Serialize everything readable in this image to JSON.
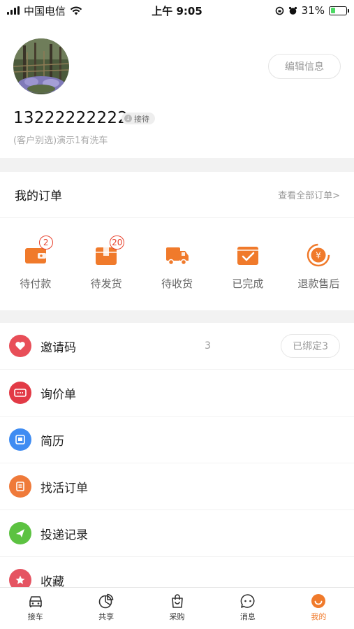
{
  "status_bar": {
    "carrier": "中国电信",
    "time": "上午 9:05",
    "battery": "31%"
  },
  "profile": {
    "phone": "13222222222",
    "role_badge": "接待",
    "subline": "(客户别选)演示1有洗车",
    "edit_label": "编辑信息"
  },
  "orders": {
    "title": "我的订单",
    "view_all": "查看全部订单>",
    "items": [
      {
        "label": "待付款",
        "badge": "2",
        "icon": "wallet-icon"
      },
      {
        "label": "待发货",
        "badge": "20",
        "icon": "package-icon"
      },
      {
        "label": "待收货",
        "badge": "",
        "icon": "truck-icon"
      },
      {
        "label": "已完成",
        "badge": "",
        "icon": "completed-box-icon"
      },
      {
        "label": "退款售后",
        "badge": "",
        "icon": "refund-icon"
      }
    ]
  },
  "menu": {
    "items": [
      {
        "label": "邀请码",
        "count": "3",
        "button": "已绑定3",
        "icon": "heart-icon",
        "color": "#e84e58"
      },
      {
        "label": "询价单",
        "icon": "quote-icon",
        "color": "#e23a46"
      },
      {
        "label": "简历",
        "icon": "resume-icon",
        "color": "#3f8cf2"
      },
      {
        "label": "找活订单",
        "icon": "job-order-icon",
        "color": "#ef7a3a"
      },
      {
        "label": "投递记录",
        "icon": "send-icon",
        "color": "#5cc241"
      },
      {
        "label": "收藏",
        "icon": "star-icon",
        "color": "#e55462"
      }
    ]
  },
  "tabbar": {
    "items": [
      {
        "label": "接车",
        "icon": "car-icon",
        "active": false
      },
      {
        "label": "共享",
        "icon": "pie-chart-icon",
        "active": false
      },
      {
        "label": "采购",
        "icon": "shopping-bag-icon",
        "active": false
      },
      {
        "label": "消息",
        "icon": "chat-icon",
        "active": false
      },
      {
        "label": "我的",
        "icon": "smile-icon",
        "active": true
      }
    ]
  },
  "colors": {
    "accent": "#f07a2b",
    "badge_red": "#e8412c"
  }
}
